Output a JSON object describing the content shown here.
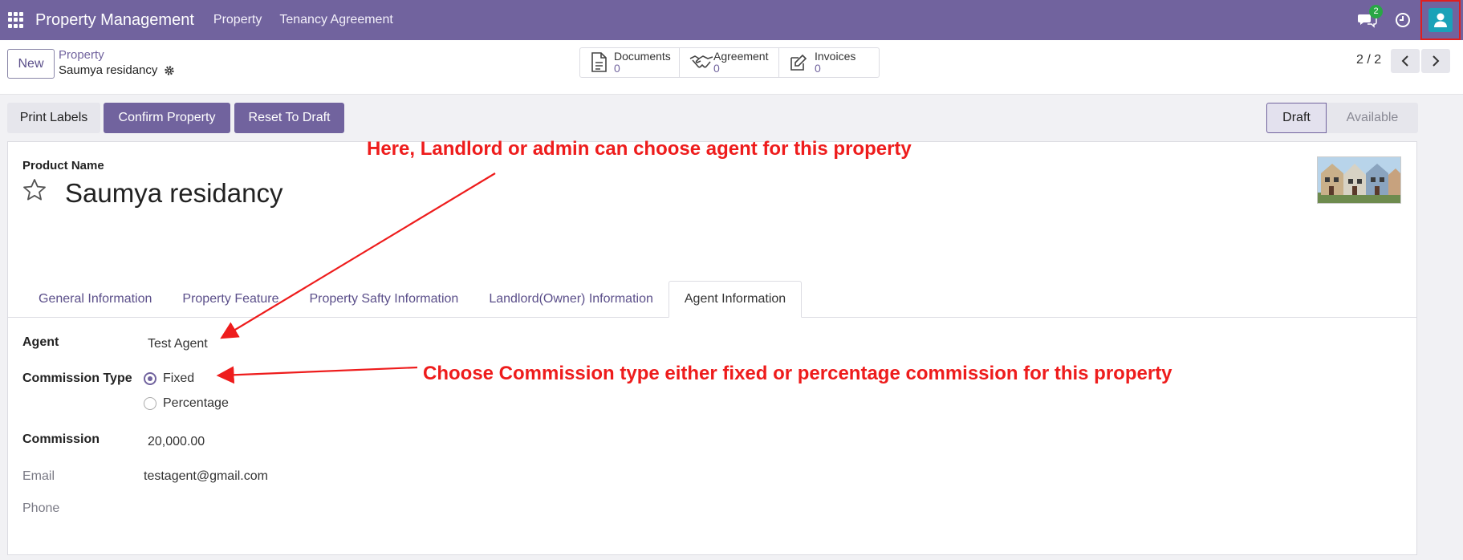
{
  "navbar": {
    "brand": "Property Management",
    "menu": [
      "Property",
      "Tenancy Agreement"
    ],
    "chat_badge": "2",
    "bg_color": "#71639e"
  },
  "control": {
    "new_label": "New",
    "breadcrumb_parent": "Property",
    "breadcrumb_current": "Saumya residancy",
    "smart_buttons": [
      {
        "label": "Documents",
        "count": "0",
        "icon": "document-icon"
      },
      {
        "label": "Agreement",
        "count": "0",
        "icon": "handshake-icon"
      },
      {
        "label": "Invoices",
        "count": "0",
        "icon": "edit-icon"
      }
    ],
    "pager": "2 / 2"
  },
  "actions": {
    "print_labels": "Print Labels",
    "confirm_property": "Confirm Property",
    "reset_to_draft": "Reset To Draft"
  },
  "status": {
    "current": "Draft",
    "next": "Available"
  },
  "form": {
    "product_name_label": "Product Name",
    "title": "Saumya residancy",
    "tabs": [
      "General Information",
      "Property Feature",
      "Property Safty Information",
      "Landlord(Owner) Information",
      "Agent Information"
    ],
    "active_tab": "Agent Information",
    "agent_label": "Agent",
    "agent_value": "Test Agent",
    "commission_type_label": "Commission Type",
    "commission_type_options": [
      "Fixed",
      "Percentage"
    ],
    "commission_type_selected": "Fixed",
    "commission_label": "Commission",
    "commission_value": "20,000.00",
    "email_label": "Email",
    "email_value": "testagent@gmail.com",
    "phone_label": "Phone"
  },
  "annotations": {
    "agent_note": "Here, Landlord or admin can choose agent for this property",
    "commission_note": "Choose Commission type either fixed or percentage commission for this property",
    "color": "#ee1c1c"
  }
}
